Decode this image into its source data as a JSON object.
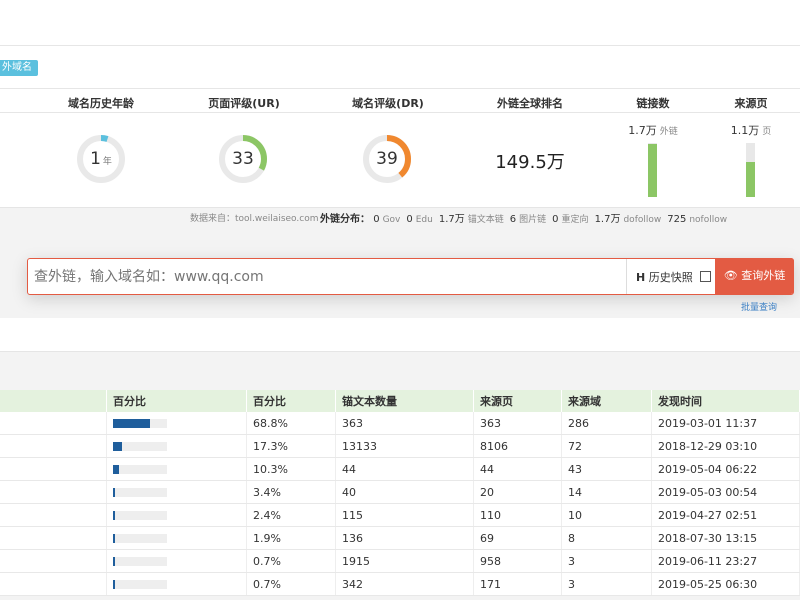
{
  "badge_label": "外域名",
  "metrics": {
    "domain_age": {
      "label": "域名历史年龄",
      "value": "1",
      "unit": "年",
      "fraction": 0.05,
      "color": "#5bc0de"
    },
    "ur": {
      "label": "页面评级(UR)",
      "value": "33",
      "fraction": 0.33,
      "color": "#8cc665"
    },
    "dr": {
      "label": "域名评级(DR)",
      "value": "39",
      "fraction": 0.39,
      "color": "#f0882f"
    },
    "global_rank": {
      "label": "外链全球排名",
      "value": "149.5万"
    },
    "links": {
      "label": "链接数",
      "value": "1.7万",
      "unit": "外链",
      "fraction": 0.98
    },
    "source_pages": {
      "label": "来源页",
      "value": "1.1万",
      "unit": "页",
      "fraction": 0.65
    }
  },
  "source_note": "数据来自：tool.weilaiseo.com",
  "distribution": {
    "label": "外链分布：",
    "items": [
      {
        "value": "0",
        "unit": "Gov"
      },
      {
        "value": "0",
        "unit": "Edu"
      },
      {
        "value": "1.7万",
        "unit": "锚文本链"
      },
      {
        "value": "6",
        "unit": "图片链"
      },
      {
        "value": "0",
        "unit": "重定向"
      },
      {
        "value": "1.7万",
        "unit": "dofollow"
      },
      {
        "value": "725",
        "unit": "nofollow"
      }
    ]
  },
  "search": {
    "placeholder": "查外链，输入域名如：www.qq.com",
    "history_label": "历史快照",
    "history_icon": "H",
    "button_icon": "eye-icon",
    "button_label": "查询外链",
    "batch_label": "批量查询"
  },
  "table": {
    "headers": [
      "",
      "百分比",
      "百分比",
      "锚文本数量",
      "来源页",
      "来源域",
      "发现时间"
    ],
    "rows": [
      {
        "pct_value": 0.688,
        "pct": "68.8%",
        "anchors": "363",
        "pages": "363",
        "domains": "286",
        "time": "2019-03-01 11:37"
      },
      {
        "pct_value": 0.173,
        "pct": "17.3%",
        "anchors": "13133",
        "pages": "8106",
        "domains": "72",
        "time": "2018-12-29 03:10"
      },
      {
        "pct_value": 0.103,
        "pct": "10.3%",
        "anchors": "44",
        "pages": "44",
        "domains": "43",
        "time": "2019-05-04 06:22"
      },
      {
        "pct_value": 0.034,
        "pct": "3.4%",
        "anchors": "40",
        "pages": "20",
        "domains": "14",
        "time": "2019-05-03 00:54"
      },
      {
        "pct_value": 0.024,
        "pct": "2.4%",
        "anchors": "115",
        "pages": "110",
        "domains": "10",
        "time": "2019-04-27 02:51"
      },
      {
        "pct_value": 0.019,
        "pct": "1.9%",
        "anchors": "136",
        "pages": "69",
        "domains": "8",
        "time": "2018-07-30 13:15"
      },
      {
        "pct_value": 0.007,
        "pct": "0.7%",
        "anchors": "1915",
        "pages": "958",
        "domains": "3",
        "time": "2019-06-11 23:27"
      },
      {
        "pct_value": 0.007,
        "pct": "0.7%",
        "anchors": "342",
        "pages": "171",
        "domains": "3",
        "time": "2019-05-25 06:30"
      }
    ]
  }
}
